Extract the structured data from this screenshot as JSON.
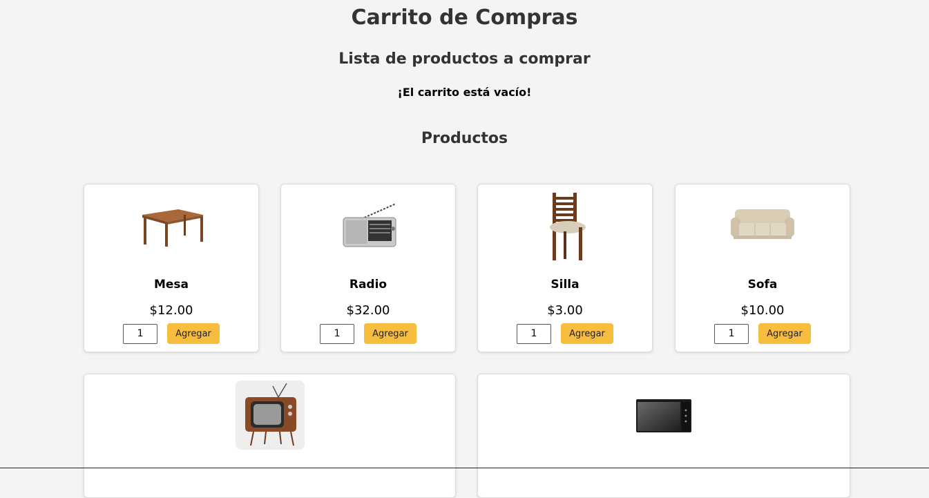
{
  "header": {
    "title": "Carrito de Compras",
    "subtitle": "Lista de productos a comprar",
    "empty_message": "¡El carrito está vacío!",
    "products_heading": "Productos"
  },
  "products": [
    {
      "name": "Mesa",
      "price": "$12.00",
      "quantity": "1",
      "button_label": "Agregar",
      "image": "table-image"
    },
    {
      "name": "Radio",
      "price": "$32.00",
      "quantity": "1",
      "button_label": "Agregar",
      "image": "radio-image"
    },
    {
      "name": "Silla",
      "price": "$3.00",
      "quantity": "1",
      "button_label": "Agregar",
      "image": "chair-image"
    },
    {
      "name": "Sofa",
      "price": "$10.00",
      "quantity": "1",
      "button_label": "Agregar",
      "image": "sofa-image"
    },
    {
      "image": "tv-image"
    },
    {
      "image": "microwave-image"
    }
  ],
  "colors": {
    "background": "#f4f4f4",
    "card": "#ffffff",
    "button": "#f6bd3e"
  }
}
